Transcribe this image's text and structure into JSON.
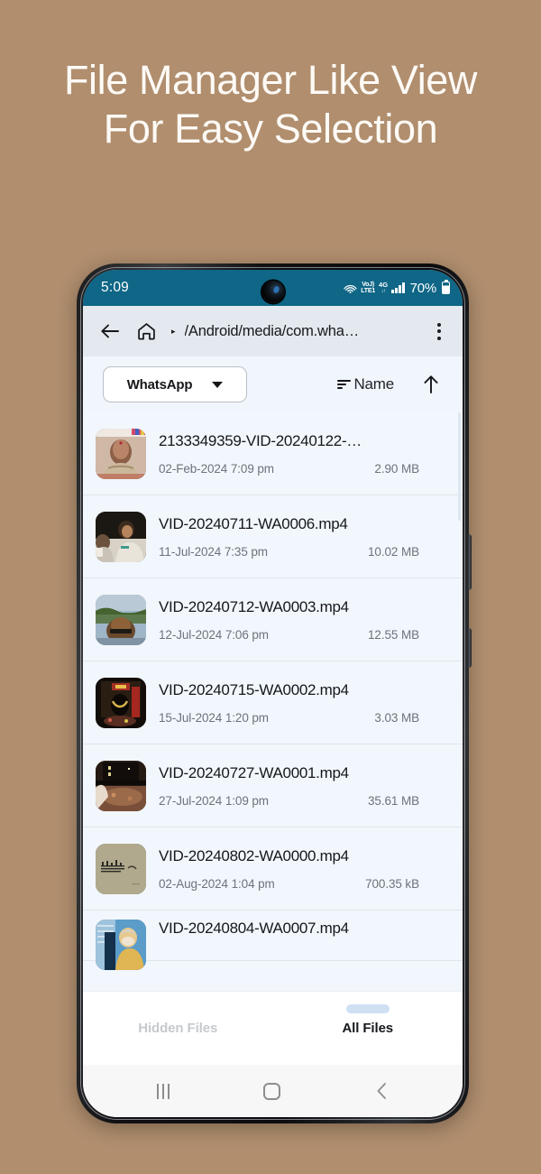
{
  "headline": {
    "line1": "File Manager Like View",
    "line2": "For Easy Selection"
  },
  "colors": {
    "background": "#b08e6e",
    "status_bar": "#0f6686",
    "toolbar": "#e4e9ef",
    "list_background": "#f2f7fd",
    "tab_indicator": "#cfe0f3"
  },
  "status_bar": {
    "time": "5:09",
    "volte_top": "VoJ)",
    "volte_bottom": "LTE1",
    "network": "4G",
    "network_arrows": "↓↑",
    "battery_percent": "70%",
    "icons": [
      "cast-icon",
      "volte-icon",
      "network-4g-icon",
      "signal-bars-icon",
      "battery-icon"
    ]
  },
  "toolbar": {
    "back_icon": "back-arrow-icon",
    "home_icon": "home-icon",
    "separator": "▸",
    "path": "/Android/media/com.wha…",
    "overflow_icon": "overflow-menu-icon"
  },
  "filterbar": {
    "app_filter": "WhatsApp",
    "dropdown_icon": "chevron-down-icon",
    "sort_icon": "sort-icon",
    "sort_label": "Name",
    "order_icon": "arrow-up-icon"
  },
  "files": [
    {
      "name": "2133349359-VID-20240122-…",
      "date": "02-Feb-2024 7:09 pm",
      "size": "2.90 MB",
      "thumb": "portrait-woman"
    },
    {
      "name": "VID-20240711-WA0006.mp4",
      "date": "11-Jul-2024 7:35 pm",
      "size": "10.02 MB",
      "thumb": "seated-people"
    },
    {
      "name": "VID-20240712-WA0003.mp4",
      "date": "12-Jul-2024 7:06 pm",
      "size": "12.55 MB",
      "thumb": "outdoor-temple"
    },
    {
      "name": "VID-20240715-WA0002.mp4",
      "date": "15-Jul-2024 1:20 pm",
      "size": "3.03 MB",
      "thumb": "shrine-dark"
    },
    {
      "name": "VID-20240727-WA0001.mp4",
      "date": "27-Jul-2024 1:09 pm",
      "size": "35.61 MB",
      "thumb": "indoor-hall"
    },
    {
      "name": "VID-20240802-WA0000.mp4",
      "date": "02-Aug-2024 1:04 pm",
      "size": "700.35 kB",
      "thumb": "document-beige"
    },
    {
      "name": "VID-20240804-WA0007.mp4",
      "date": "",
      "size": "",
      "thumb": "person-yellow"
    }
  ],
  "tabs": [
    {
      "label": "Hidden Files",
      "active": false
    },
    {
      "label": "All Files",
      "active": true
    }
  ],
  "navbar": {
    "recents_icon": "recents-icon",
    "home_icon": "home-button-icon",
    "back_icon": "back-button-icon"
  }
}
